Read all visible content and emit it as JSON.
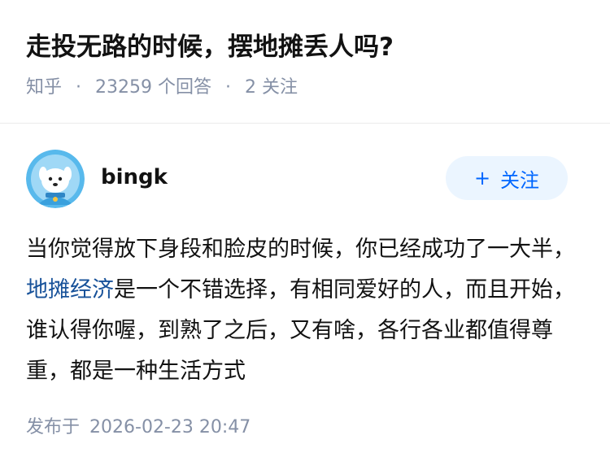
{
  "question": {
    "title": "走投无路的时候，摆地摊丢人吗?",
    "source": "知乎",
    "answer_count": "23259",
    "answer_label": "个回答",
    "follow_count": "2",
    "follow_label": "关注"
  },
  "author": {
    "name": "bingk",
    "follow_button_label": "关注"
  },
  "answer": {
    "text_part1": "当你觉得放下身段和脸皮的时候，你已经成功了一大半，",
    "link_text": "地摊经济",
    "text_part2": "是一个不错选择，有相同爱好的人，而且开始，谁认得你喔，到熟了之后，又有啥，各行各业都值得尊重，都是一种生活方式",
    "publish_label": "发布于",
    "publish_time": "2026-02-23 20:47"
  },
  "colors": {
    "accent": "#0066ff",
    "link": "#175199",
    "meta": "#8590a6",
    "follow_bg": "#ebf5ff"
  },
  "icons": {
    "avatar": "dog-avatar-icon",
    "follow": "plus-icon"
  }
}
